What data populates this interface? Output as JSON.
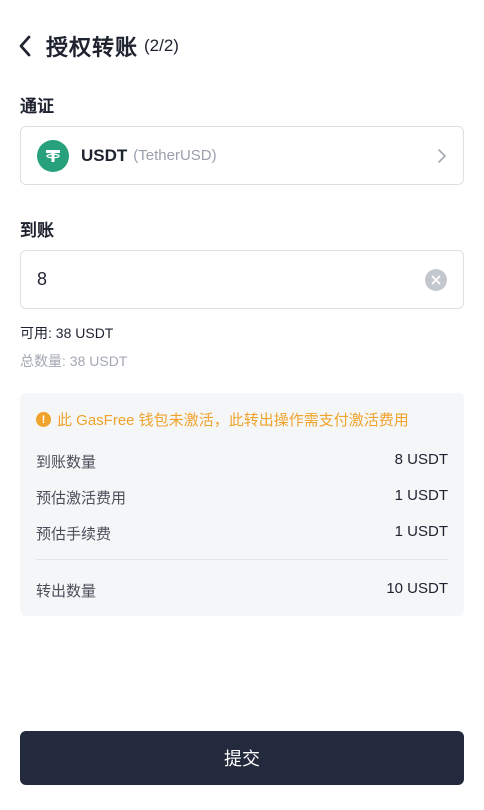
{
  "header": {
    "title": "授权转账",
    "step": "(2/2)"
  },
  "token_section": {
    "label": "通证",
    "symbol": "USDT",
    "name": "(TetherUSD)",
    "icon": "tether-icon"
  },
  "amount_section": {
    "label": "到账",
    "value": "8"
  },
  "balance": {
    "available": "可用: 38 USDT",
    "total": "总数量: 38 USDT"
  },
  "info": {
    "warning": "此 GasFree 钱包未激活，此转出操作需支付激活费用",
    "rows": [
      {
        "key": "到账数量",
        "value": "8 USDT"
      },
      {
        "key": "预估激活费用",
        "value": "1 USDT"
      },
      {
        "key": "预估手续费",
        "value": "1 USDT"
      }
    ],
    "total": {
      "key": "转出数量",
      "value": "10 USDT"
    }
  },
  "submit": {
    "label": "提交"
  },
  "colors": {
    "accent": "#232a3d",
    "warning": "#f0a32b",
    "tether": "#26a17b"
  }
}
